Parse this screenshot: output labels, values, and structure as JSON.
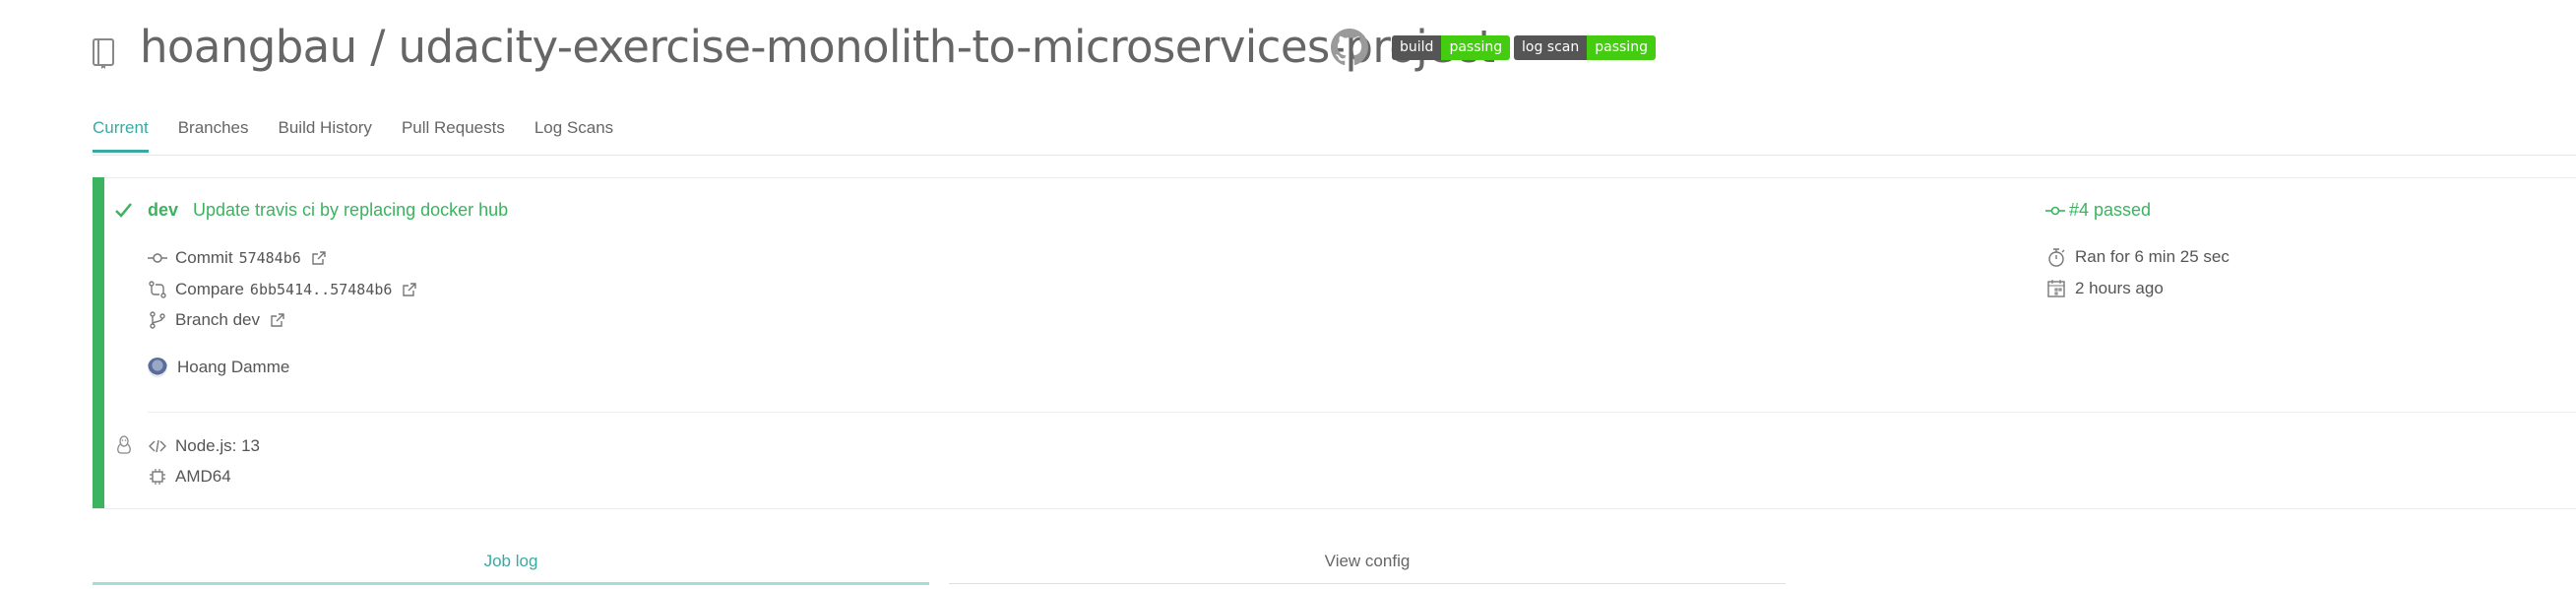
{
  "header": {
    "title": "hoangbau / udacity-exercise-monolith-to-microservices-project",
    "icons": [
      "repo-icon",
      "github-icon"
    ],
    "badges": [
      {
        "label": "build",
        "value": "passing",
        "label_color": "#555555",
        "value_color": "#44cc11"
      },
      {
        "label": "log scan",
        "value": "passing",
        "label_color": "#555555",
        "value_color": "#44cc11"
      }
    ]
  },
  "tabs": [
    {
      "label": "Current",
      "active": true
    },
    {
      "label": "Branches"
    },
    {
      "label": "Build History"
    },
    {
      "label": "Pull Requests"
    },
    {
      "label": "Log Scans"
    }
  ],
  "build": {
    "status_color": "#3bb35f",
    "branch": "dev",
    "message": "Update travis ci by replacing docker hub",
    "commit_label": "Commit",
    "commit_sha": "57484b6",
    "compare_label": "Compare",
    "compare_range": "6bb5414..57484b6",
    "branch_label": "Branch dev",
    "author": "Hoang Damme",
    "language": "Node.js: 13",
    "arch": "AMD64",
    "build_number": "#4 passed",
    "duration": "Ran for 6 min 25 sec",
    "finished": "2 hours ago"
  },
  "bottom_tabs": {
    "job_log": "Job log",
    "view_config": "View config"
  },
  "colors": {
    "accent": "#39aaa1",
    "passed": "#3bb35f"
  }
}
